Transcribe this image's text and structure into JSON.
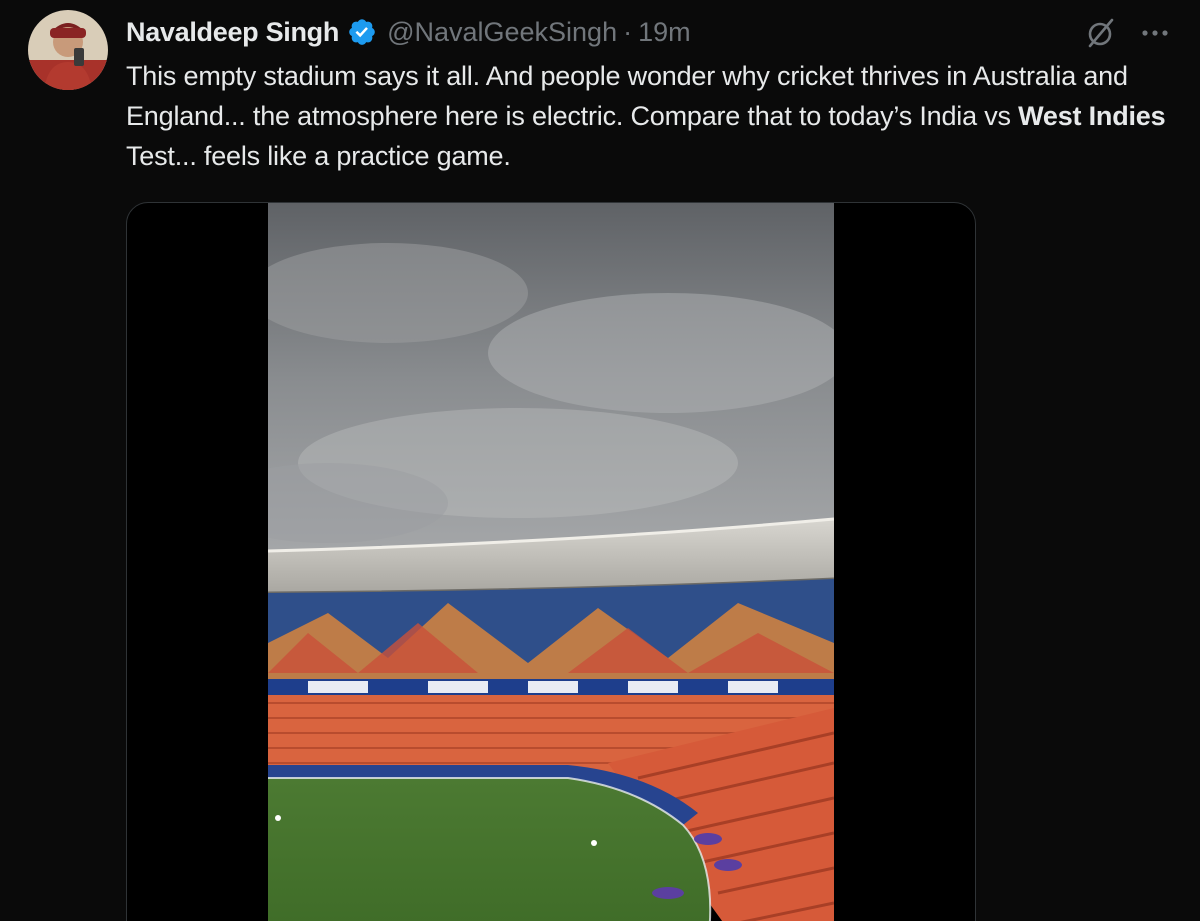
{
  "tweet": {
    "author_name": "Navaldeep Singh",
    "handle": "@NavalGeekSingh",
    "separator": "·",
    "timestamp": "19m",
    "verified": true,
    "text_part1": "This empty stadium says it all. And people wonder why cricket thrives in Australia and England... the atmosphere here is electric. Compare that to today’s India vs ",
    "text_bold": "West Indies",
    "text_part2": " Test... feels like a practice game.",
    "icons": {
      "verified": "verified-badge-icon",
      "grok": "grok-icon",
      "more": "more-options-icon"
    },
    "colors": {
      "background": "#0a0a0a",
      "text": "#e7e9ea",
      "muted": "#71767b",
      "verified": "#1d9bf0"
    }
  }
}
